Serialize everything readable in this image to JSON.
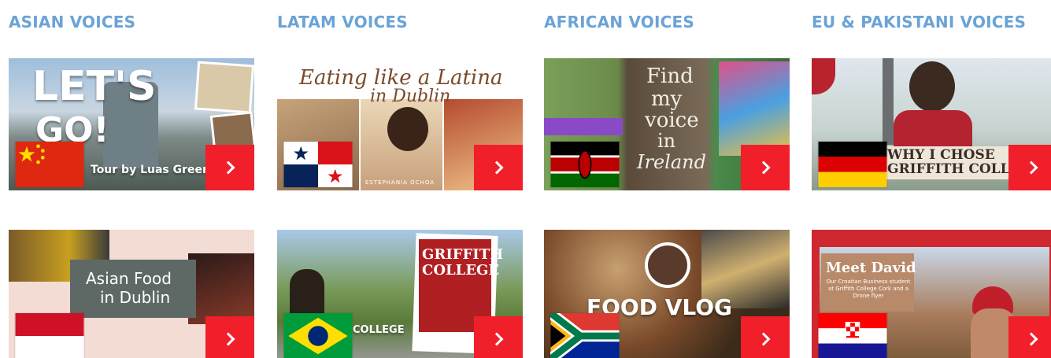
{
  "columns": [
    {
      "title": "ASIAN VOICES"
    },
    {
      "title": "LATAM VOICES"
    },
    {
      "title": "AFRICAN VOICES"
    },
    {
      "title": "EU & PAKISTANI VOICES"
    }
  ],
  "cards": {
    "asian_1": {
      "headline_1": "LET'S",
      "headline_2": "GO!",
      "caption": "Tour by Luas Green",
      "flag": "china-flag-icon"
    },
    "latam_1": {
      "headline": "Eating like a Latina",
      "headline_2": "in Dublin",
      "caption": "ESTEPHANIA OCHOA",
      "flag": "panama-flag-icon"
    },
    "african_1": {
      "line_1": "Find",
      "line_2": "my",
      "line_3": "voice",
      "line_4": "in",
      "line_5": "Ireland",
      "flag": "kenya-flag-icon"
    },
    "eu_1": {
      "banner": "WHY I CHOSE",
      "banner_2": "GRIFFITH COLLEGE?",
      "flag": "germany-flag-icon"
    },
    "asian_2": {
      "title_1": "Asian Food",
      "title_2": "in Dublin",
      "flag": "indonesia-flag-icon"
    },
    "latam_2": {
      "sign": "GRIFFITH COLLEGE",
      "caption": "COLLEGE",
      "flag": "brazil-flag-icon"
    },
    "african_2": {
      "title": "FOOD VLOG",
      "flag": "south-africa-flag-icon"
    },
    "eu_2": {
      "title": "Meet David",
      "subtitle": "Our Croatian Business student at Griffith College Cork and a Drone flyer",
      "flag": "croatia-flag-icon"
    }
  },
  "icons": {
    "go": "chevron-right-icon"
  },
  "colors": {
    "title": "#6aa3d6",
    "button": "#f01f2a"
  }
}
